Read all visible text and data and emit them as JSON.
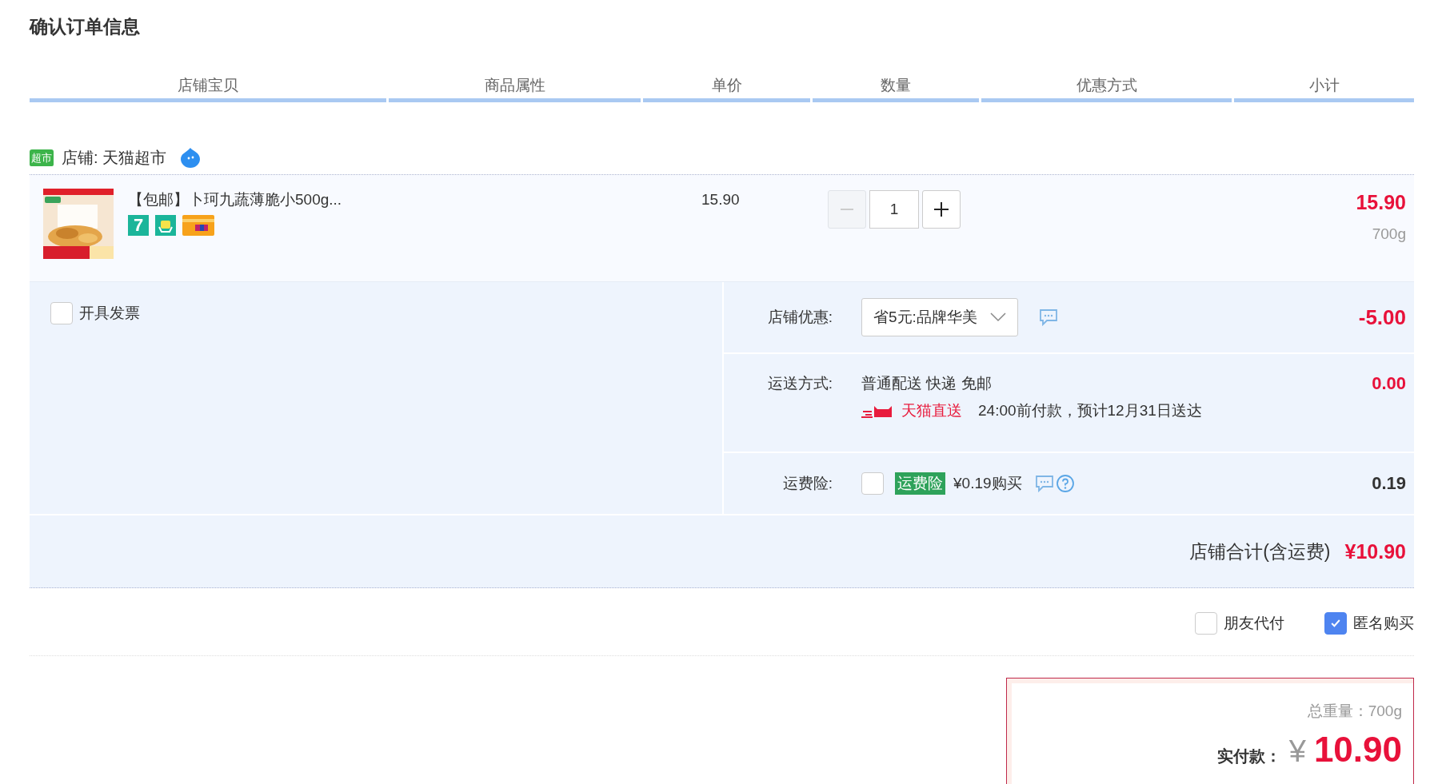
{
  "page_title": "确认订单信息",
  "columns": [
    "店铺宝贝",
    "商品属性",
    "单价",
    "数量",
    "优惠方式",
    "小计"
  ],
  "shop": {
    "badge": "超市",
    "label": "店铺: 天猫超市"
  },
  "item": {
    "kind": "picture",
    "title": "【包邮】卜珂九蔬薄脆小500g...",
    "badges": [
      {
        "kind": "seven",
        "text": "7"
      },
      {
        "kind": "bag"
      },
      {
        "kind": "card"
      }
    ],
    "price": "15.90",
    "quantity": "1",
    "minus_disabled": true,
    "subtotal": "15.90",
    "weight": "700g"
  },
  "invoice": {
    "label": "开具发票",
    "checked": false
  },
  "discount": {
    "label": "店铺优惠:",
    "value": "省5元:品牌华美",
    "amount": "-5.00"
  },
  "shipping": {
    "label": "运送方式:",
    "method": "普通配送 快递 免邮",
    "brand": "天猫直送",
    "eta": "24:00前付款，预计12月31日送达",
    "amount": "0.00"
  },
  "insurance": {
    "label": "运费险:",
    "checked": false,
    "tag": "运费险",
    "price": "¥0.19购买",
    "amount": "0.19"
  },
  "shop_total": {
    "label": "店铺合计(含运费)",
    "value": "¥10.90"
  },
  "options": [
    {
      "label": "朋友代付",
      "checked": false
    },
    {
      "label": "匿名购买",
      "checked": true
    }
  ],
  "summary": {
    "weight": "总重量：700g",
    "pay_label": "实付款：",
    "currency": "¥",
    "amount": "10.90"
  }
}
